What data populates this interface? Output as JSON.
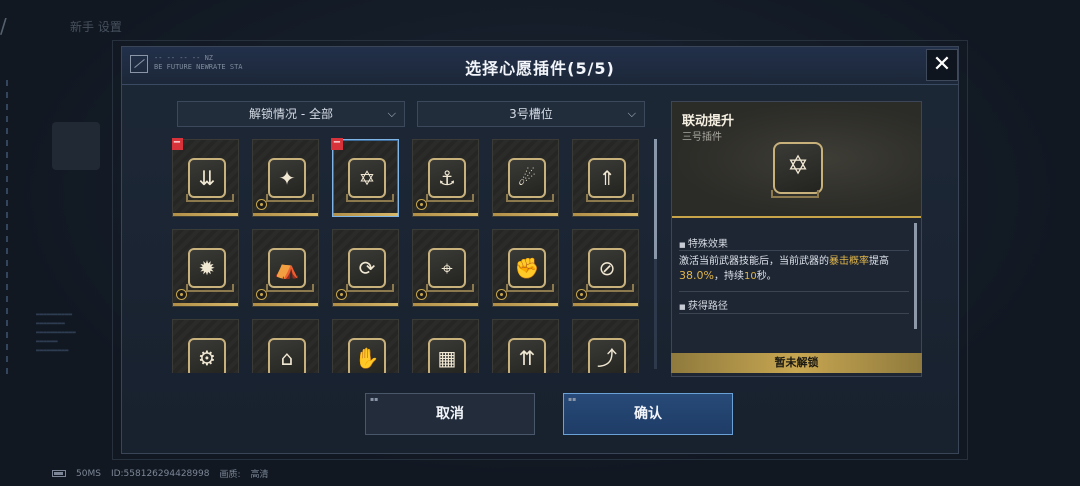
{
  "background": {
    "back_text": "新手 设置",
    "footer": {
      "latency": "50MS",
      "id": "ID:558126294428998",
      "quality_label": "画质:",
      "quality_value": "高清"
    }
  },
  "modal": {
    "title": "选择心愿插件(5/5)",
    "logo_text_line1": "-- -- -- -- NZ",
    "logo_text_line2": "BE FUTURE NEWRATE  STA",
    "close_symbol": "✕"
  },
  "filters": {
    "unlock": {
      "label": "解锁情况 - 全部",
      "icon": "chevron-down-icon"
    },
    "slot": {
      "label": "3号槽位",
      "icon": "chevron-down-icon"
    }
  },
  "plugins": [
    {
      "glyph": "⇊",
      "icon": "arrows-down-icon",
      "removable": true,
      "tier": false
    },
    {
      "glyph": "✦",
      "icon": "winged-blade-icon",
      "removable": false,
      "tier": true
    },
    {
      "glyph": "✡",
      "icon": "hex-star-icon",
      "removable": true,
      "tier": false,
      "selected": true
    },
    {
      "glyph": "⚓",
      "icon": "anchor-icon",
      "removable": false,
      "tier": true
    },
    {
      "glyph": "☄",
      "icon": "comet-icon",
      "removable": false,
      "tier": false
    },
    {
      "glyph": "⇑",
      "icon": "arrows-up-icon",
      "removable": false,
      "tier": false
    },
    {
      "glyph": "✹",
      "icon": "burst-icon",
      "removable": false,
      "tier": true
    },
    {
      "glyph": "⛺",
      "icon": "rocket-cycle-icon",
      "removable": false,
      "tier": true
    },
    {
      "glyph": "⟳",
      "icon": "spiral-icon",
      "removable": false,
      "tier": true
    },
    {
      "glyph": "⌖",
      "icon": "crosshair-icon",
      "removable": false,
      "tier": true
    },
    {
      "glyph": "✊",
      "icon": "fist-icon",
      "removable": false,
      "tier": true
    },
    {
      "glyph": "⊘",
      "icon": "crossed-circle-icon",
      "removable": false,
      "tier": true
    },
    {
      "glyph": "⚙",
      "icon": "gear-circle-icon",
      "removable": false,
      "tier": false
    },
    {
      "glyph": "⌂",
      "icon": "shield-house-icon",
      "removable": false,
      "tier": false
    },
    {
      "glyph": "✋",
      "icon": "hand-icon",
      "removable": false,
      "tier": false
    },
    {
      "glyph": "▦",
      "icon": "grid-block-icon",
      "removable": false,
      "tier": false
    },
    {
      "glyph": "⇈",
      "icon": "multi-arrow-icon",
      "removable": false,
      "tier": false
    },
    {
      "glyph": "⤴",
      "icon": "ramp-icon",
      "removable": false,
      "tier": false
    }
  ],
  "detail": {
    "title": "联动提升",
    "subtitle": "三号插件",
    "glyph": "✡",
    "effect_header": "特殊效果",
    "effect_part1": "激活当前武器技能后，当前武器的",
    "effect_hl1": "暴击概率",
    "effect_part2": "提高",
    "effect_value": "38.0%",
    "effect_part3": "，持续",
    "effect_duration": "10",
    "effect_part4": "秒。",
    "obtain_header": "获得路径",
    "lock_status": "暂未解锁"
  },
  "buttons": {
    "cancel": "取消",
    "confirm": "确认"
  },
  "colors": {
    "accent_gold": "#e0b64b",
    "confirm_blue": "#284a78",
    "remove_red": "#d8323a"
  }
}
